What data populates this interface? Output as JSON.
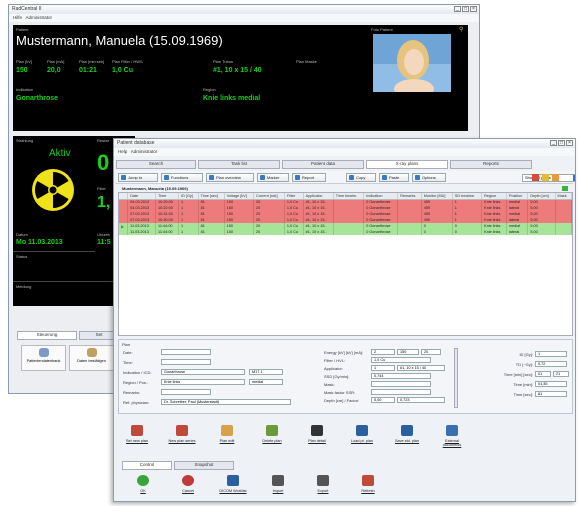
{
  "back": {
    "title": "RadCentral II",
    "menu": {
      "help": "Hilfe",
      "admin": "Administrator"
    },
    "patient_label": "Patient",
    "patient_name": "Mustermann, Manuela (15.09.1969)",
    "photo_label": "Foto Patient",
    "fields": [
      {
        "label": "Plan [kV]",
        "value": "150"
      },
      {
        "label": "Plan [mA]",
        "value": "20,0"
      },
      {
        "label": "Plan [min:sek]",
        "value": "01:21"
      },
      {
        "label": "Plan Filter / HWS",
        "value": "1,0 Cu"
      },
      {
        "label": "Plan Tubus",
        "value": "#1, 10 x 15 / 40"
      },
      {
        "label": "Plan Maske",
        "value": ""
      }
    ],
    "indication_label": "Indikation",
    "indication": "Gonarthrose",
    "region_label": "Region",
    "region": "Knie links medial",
    "radiation_label": "Strahlung",
    "radiation": "Aktiv",
    "rest_label": "Restze",
    "rest_value": "0",
    "filter_label": "Filter",
    "filter_value": "1,",
    "date_label": "Datum",
    "date": "Mo 11.03.2013",
    "time_label": "Uhrzeit",
    "time": "11:5",
    "status_label": "Status",
    "message_label": "Meldung",
    "tabs": [
      "Steuerung",
      "Set"
    ],
    "buttons": [
      "Patientendatenbank",
      "Daten bestätigen"
    ]
  },
  "front": {
    "title": "Patient database",
    "menu": {
      "help": "Help",
      "admin": "Administrator"
    },
    "tabs": [
      "Search",
      "Task list",
      "Patient data",
      "X-ray plans",
      "Reports"
    ],
    "toolbar": [
      "Jump to",
      "Functions",
      "Plan overview",
      "Marker",
      "Report",
      "Copy",
      "Paste",
      "Options"
    ],
    "filter_value": "Show all plans",
    "patient_header": "Mustermann, Manuela (15.09.1969)",
    "columns": [
      "Date",
      "Time",
      "ID [Gy]",
      "Time [sec]",
      "Voltage [kV]",
      "Current [mA]",
      "Filter",
      "Applicator",
      "Time treatm.",
      "Indication",
      "Remarks",
      "Monitor [MU]",
      "SD treatme.",
      "Region",
      "Position",
      "Depth [cm]",
      "Mask"
    ],
    "rows": [
      {
        "s": "red",
        "c": [
          "04.03.2013",
          "10:20:00",
          "1",
          "81",
          "150",
          "20",
          "1,0 Cu",
          "#1, 10 x 15..",
          "",
          "0 Gonarthrose",
          "",
          "459",
          "1",
          "Knie links",
          "medial",
          "5,00",
          ""
        ]
      },
      {
        "s": "red",
        "c": [
          "04.03.2013",
          "10:22:00",
          "1",
          "81",
          "150",
          "20",
          "1,0 Cu",
          "#1, 10 x 15..",
          "",
          "0 Gonarthrose",
          "",
          "459",
          "1",
          "Knie links",
          "lateral",
          "5,00",
          ""
        ]
      },
      {
        "s": "red",
        "c": [
          "07.03.2013",
          "10:31:00",
          "1",
          "81",
          "150",
          "20",
          "1,0 Cu",
          "#1, 10 x 15..",
          "",
          "0 Gonarthrose",
          "",
          "459",
          "1",
          "Knie links",
          "medial",
          "5,00",
          ""
        ]
      },
      {
        "s": "red",
        "c": [
          "07.03.2013",
          "10:30:00",
          "1",
          "81",
          "150",
          "20",
          "1,0 Cu",
          "#1, 10 x 15..",
          "",
          "0 Gonarthrose",
          "",
          "459",
          "1",
          "Knie links",
          "lateral",
          "5,00",
          ""
        ]
      },
      {
        "s": "green",
        "c": [
          "11.03.2013",
          "11:44:00",
          "1",
          "81",
          "150",
          "20",
          "1,0 Cu",
          "#1, 10 x 15..",
          "",
          "0 Gonarthrose",
          "",
          "0",
          "0",
          "Knie links",
          "medial",
          "5,00",
          ""
        ]
      },
      {
        "s": "green",
        "c": [
          "11.03.2013",
          "11:44:00",
          "1",
          "81",
          "150",
          "20",
          "1,0 Cu",
          "#1, 10 x 15..",
          "",
          "0 Gonarthrose",
          "",
          "0",
          "0",
          "Knie links",
          "lateral",
          "5,00",
          ""
        ]
      }
    ],
    "plan_label": "Plan",
    "form_left": [
      {
        "label": "Date:",
        "value": ""
      },
      {
        "label": "Time:",
        "value": ""
      },
      {
        "label": "Indication / ICD:",
        "value": "Gonarthrose",
        "extra": "M17.1"
      },
      {
        "label": "Region / Pos.:",
        "value": "Knie links",
        "extra": "medial"
      },
      {
        "label": "Remarks:",
        "value": ""
      },
      {
        "label": "Ref. physician:",
        "value": "Dr. Schreiber, Paul (Musterstadt)"
      }
    ],
    "form_mid": [
      {
        "label": "Energy [kV] [kV] [mA]:",
        "value": "2",
        "v2": "150",
        "v3": "20"
      },
      {
        "label": "Filter / HVL:",
        "value": "1,0 Cu"
      },
      {
        "label": "Applicator:",
        "value": "1",
        "v2": "#1, 10 x 15 / 40"
      },
      {
        "label": "SSD [Gy/min]:",
        "value": "0,744"
      },
      {
        "label": "Mask:",
        "value": ""
      },
      {
        "label": "Mask factor SSR:",
        "value": ""
      },
      {
        "label": "Depth [cm] / Factor:",
        "value": "5,00",
        "v2": "0,723"
      }
    ],
    "form_right": [
      {
        "label": "ID [Gy]:",
        "value": "1"
      },
      {
        "label": "TD [~Gy]:",
        "value": "0,72"
      },
      {
        "label": "Time [min] [sec]:",
        "value": "01",
        "v2": "21"
      },
      {
        "label": "Time [min]:",
        "value": "01,35"
      },
      {
        "label": "Time [sec]:",
        "value": "81"
      }
    ],
    "actions": [
      "Set new plan",
      "New plan series",
      "Plan edit",
      "Delete plan",
      "Plan detail",
      "Load pt. plan",
      "Save std. plan",
      "External documents"
    ],
    "bottom_tabs": [
      "Control",
      "Snapshot"
    ],
    "bottom_actions": [
      "OK",
      "Cancel",
      "DICOM Worklist",
      "Import",
      "Export",
      "Refresh"
    ]
  }
}
